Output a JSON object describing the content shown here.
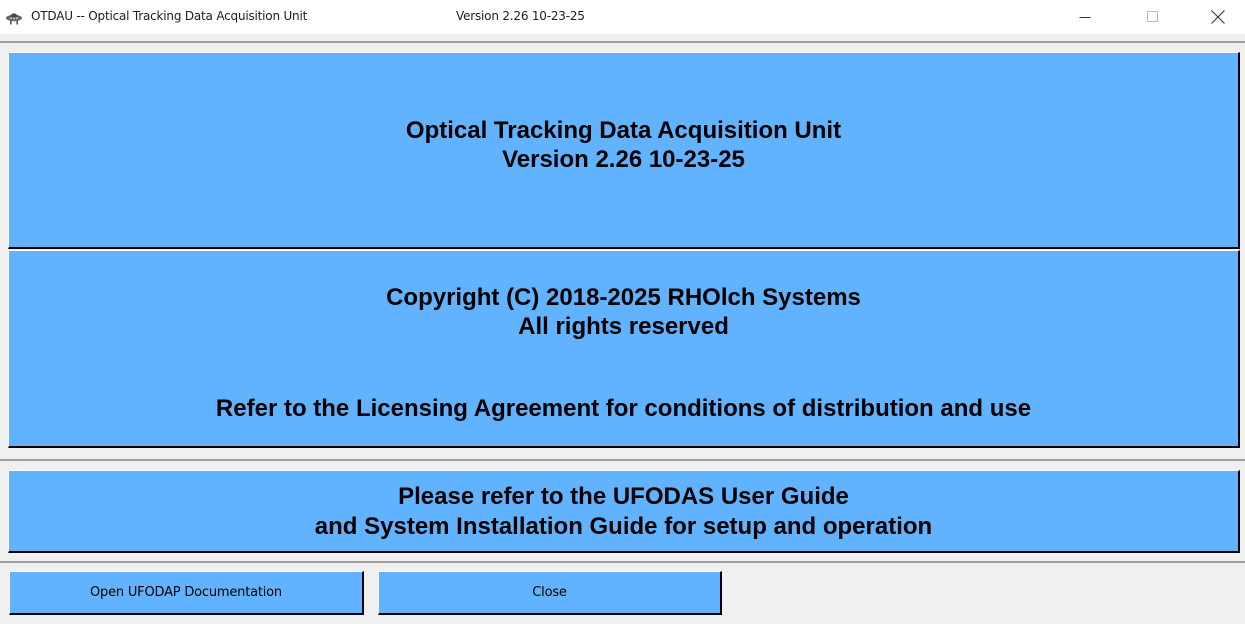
{
  "window": {
    "title": "OTDAU -- Optical Tracking Data Acquisition Unit",
    "version": "Version 2.26 10-23-25",
    "icon": "ufo-icon",
    "controls": {
      "minimize": "minimize-icon",
      "maximize": "maximize-icon",
      "close": "close-icon"
    }
  },
  "panels": {
    "header": {
      "line1": "Optical Tracking Data Acquisition Unit",
      "line2": "Version 2.26 10-23-25"
    },
    "copyright": {
      "line1": "Copyright (C) 2018-2025 RHOlch Systems",
      "line2": "All rights reserved",
      "line3": "Refer to the Licensing Agreement for conditions of distribution and use"
    },
    "guide": {
      "line1": "Please refer to the UFODAS User Guide",
      "line2": "and System Installation Guide for setup and operation"
    }
  },
  "buttons": {
    "open_docs": "Open UFODAP Documentation",
    "close": "Close"
  },
  "colors": {
    "panel": "#61b3ff",
    "background": "#f0f0f0"
  }
}
